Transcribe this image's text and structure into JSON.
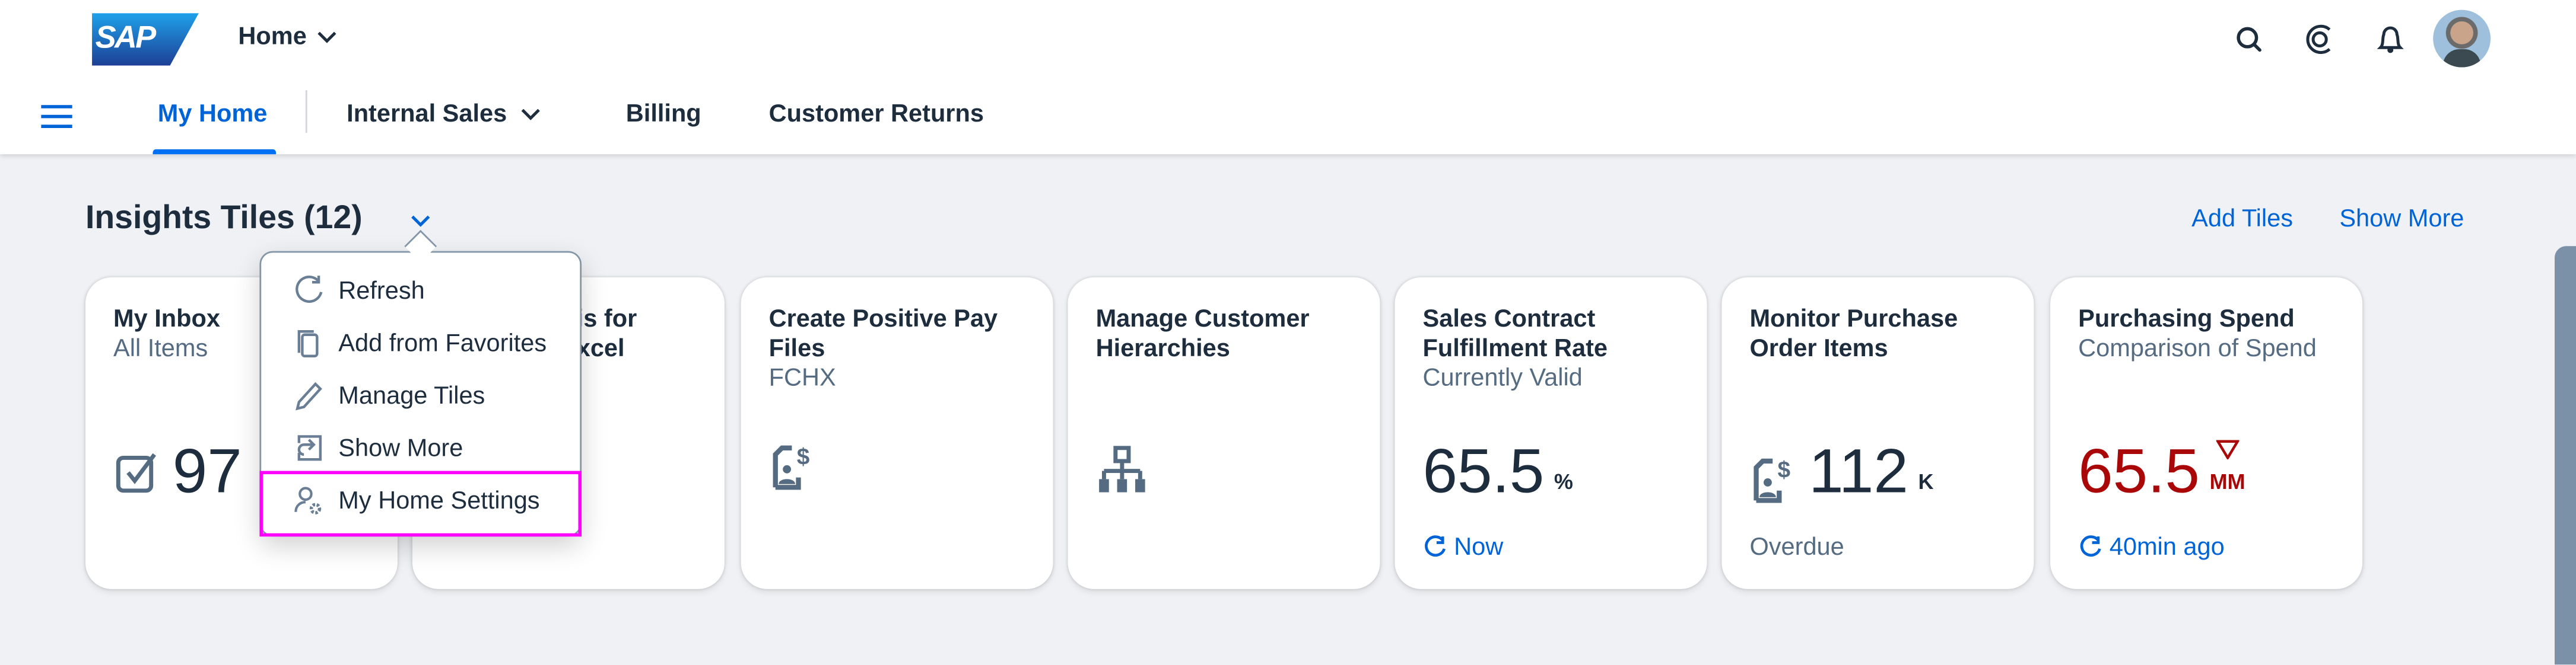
{
  "shell": {
    "logo": "SAP",
    "home_menu": "Home",
    "icons": [
      "search-icon",
      "joule-icon",
      "bell-icon",
      "user-avatar"
    ]
  },
  "nav": {
    "tabs": [
      {
        "label": "My Home",
        "selected": true
      },
      {
        "label": "Internal Sales",
        "has_menu": true
      },
      {
        "label": "Billing"
      },
      {
        "label": "Customer Returns"
      }
    ]
  },
  "section": {
    "title": "Insights Tiles (12)",
    "add_tiles": "Add Tiles",
    "show_more": "Show More"
  },
  "menu": {
    "items": [
      {
        "label": "Refresh",
        "icon": "refresh-icon"
      },
      {
        "label": "Add from Favorites",
        "icon": "copy-icon"
      },
      {
        "label": "Manage Tiles",
        "icon": "edit-icon"
      },
      {
        "label": "Show More",
        "icon": "navigate-icon"
      },
      {
        "label": "My Home Settings",
        "icon": "user-settings-icon",
        "highlighted": true
      }
    ]
  },
  "tiles": [
    {
      "title": "My Inbox",
      "subtitle": "All Items",
      "value": "97",
      "icon": "task-icon"
    },
    {
      "title_line1": "is for",
      "title_line2": "xcel"
    },
    {
      "title": "Create Positive Pay Files",
      "subtitle": "FCHX",
      "icon": "payment-document-icon"
    },
    {
      "title": "Manage Customer Hierarchies",
      "icon": "hierarchy-icon"
    },
    {
      "title": "Sales Contract Fulfillment Rate",
      "subtitle": "Currently Valid",
      "value": "65.5",
      "unit": "%",
      "footer": "Now"
    },
    {
      "title": "Monitor Purchase Order Items",
      "value": "112",
      "unit": "K",
      "footer": "Overdue",
      "icon": "payment-document-icon"
    },
    {
      "title": "Purchasing Spend",
      "subtitle": "Comparison of Spend",
      "value": "65.5",
      "unit": "MM",
      "trend": "down",
      "footer": "40min ago",
      "value_color": "#aa0808"
    }
  ],
  "colors": {
    "accent": "#0064d9",
    "negative": "#aa0808",
    "highlight": "#ff00ff"
  }
}
